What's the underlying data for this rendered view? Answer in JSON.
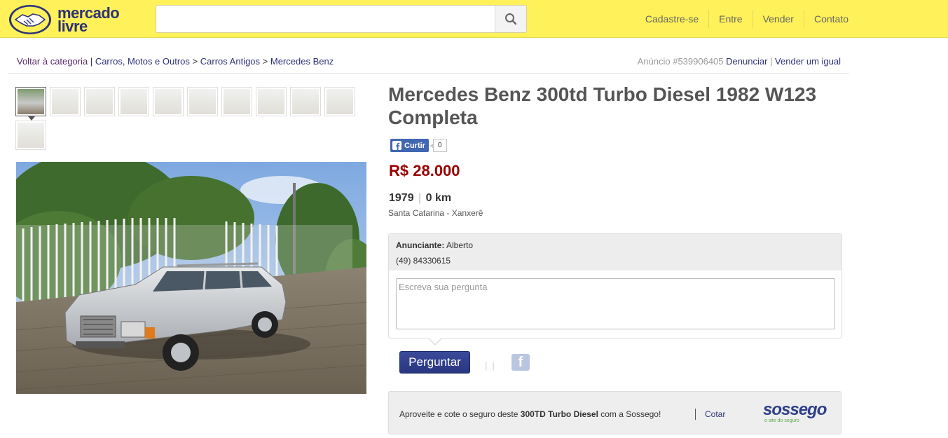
{
  "header": {
    "logo_line1": "mercado",
    "logo_line2": "livre",
    "search": {
      "value": "",
      "placeholder": ""
    },
    "nav": [
      "Cadastre-se",
      "Entre",
      "Vender",
      "Contato"
    ]
  },
  "breadcrumb": {
    "back": "Voltar à categoria",
    "items": [
      "Carros, Motos e Outros",
      "Carros Antigos",
      "Mercedes Benz"
    ],
    "separator": ">"
  },
  "ad": {
    "id_label": "Anúncio #539906405",
    "report": "Denunciar",
    "sell_similar": "Vender um igual"
  },
  "gallery": {
    "thumbnail_count": 11,
    "active_index": 0
  },
  "listing": {
    "title": "Mercedes Benz 300td Turbo Diesel 1982 W123 Completa",
    "like_label": "Curtir",
    "like_count": "0",
    "price": "R$ 28.000",
    "year": "1979",
    "mileage": "0 km",
    "location": "Santa Catarina - Xanxerê"
  },
  "seller": {
    "label": "Anunciante:",
    "name": "Alberto",
    "phone": "(49) 84330615",
    "question_placeholder": "Escreva sua pergunta",
    "ask_button": "Perguntar"
  },
  "insurance": {
    "text_before": "Aproveite e cote o seguro deste ",
    "model": "300TD Turbo Diesel",
    "text_after": " com a Sossego!",
    "link": "Cotar",
    "brand": "sossego",
    "tagline": "o site do seguro"
  },
  "colors": {
    "header_bg": "#fff159",
    "brand_blue": "#2d3277",
    "price": "#990000"
  }
}
